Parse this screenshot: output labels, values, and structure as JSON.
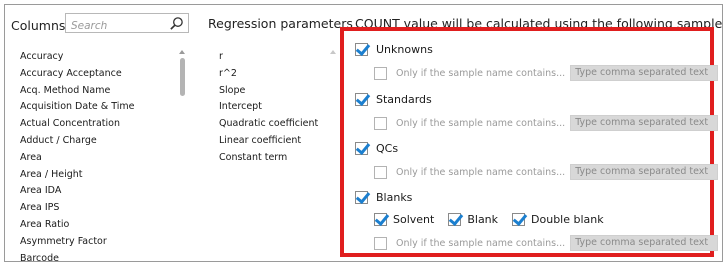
{
  "columns": {
    "title": "Columns",
    "search_placeholder": "Search",
    "items": [
      "Accuracy",
      "Accuracy Acceptance",
      "Acq. Method Name",
      "Acquisition Date & Time",
      "Actual Concentration",
      "Adduct / Charge",
      "Area",
      "Area / Height",
      "Area IDA",
      "Area IPS",
      "Area Ratio",
      "Asymmetry Factor",
      "Barcode"
    ]
  },
  "regression": {
    "title": "Regression parameters",
    "items": [
      "r",
      "r^2",
      "Slope",
      "Intercept",
      "Quadratic coefficient",
      "Linear coefficient",
      "Constant term"
    ]
  },
  "count": {
    "title": "COUNT value will be calculated using the following sample types:",
    "sample_filter_label": "Only if the sample name contains...",
    "text_placeholder": "Type comma separated text",
    "unknowns": {
      "label": "Unknowns",
      "checked": true
    },
    "standards": {
      "label": "Standards",
      "checked": true
    },
    "qcs": {
      "label": "QCs",
      "checked": true
    },
    "blanks": {
      "label": "Blanks",
      "checked": true,
      "subtypes": [
        {
          "label": "Solvent",
          "checked": true
        },
        {
          "label": "Blank",
          "checked": true
        },
        {
          "label": "Double blank",
          "checked": true
        }
      ]
    }
  },
  "colors": {
    "highlight_border": "#e01e1e",
    "checkmark": "#1b7fcf",
    "disabled_field": "#d8d8d8"
  }
}
